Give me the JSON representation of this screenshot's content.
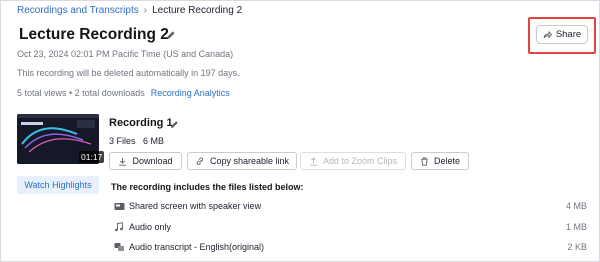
{
  "breadcrumb": {
    "parent": "Recordings and Transcripts",
    "separator": "›",
    "current": "Lecture Recording 2"
  },
  "page": {
    "title": "Lecture Recording 2",
    "date": "Oct 23, 2024 02:01 PM Pacific Time (US and Canada)",
    "delete_notice": "This recording will be deleted automatically in 197 days.",
    "stats": "5 total views • 2 total downloads",
    "analytics_link": "Recording Analytics"
  },
  "share": {
    "label": "Share",
    "icon": "share-arrow-icon"
  },
  "recording": {
    "title": "Recording 1",
    "files_summary": "3 Files   6 MB",
    "duration": "01:17",
    "watch_highlights": "Watch Highlights",
    "actions": {
      "download": "Download",
      "copy_link": "Copy shareable link",
      "add_to_clips": "Add to Zoom Clips",
      "delete": "Delete"
    }
  },
  "files": {
    "heading": "The recording includes the files listed below:",
    "items": [
      {
        "name": "Shared screen with speaker view",
        "size": "4 MB",
        "icon": "video-file-icon"
      },
      {
        "name": "Audio only",
        "size": "1 MB",
        "icon": "music-note-icon"
      },
      {
        "name": "Audio transcript - English(original)",
        "size": "2 KB",
        "icon": "transcript-icon"
      }
    ]
  },
  "colors": {
    "link": "#2d6fc9",
    "highlight_border": "#e0463f",
    "muted_text": "#6e7680"
  }
}
